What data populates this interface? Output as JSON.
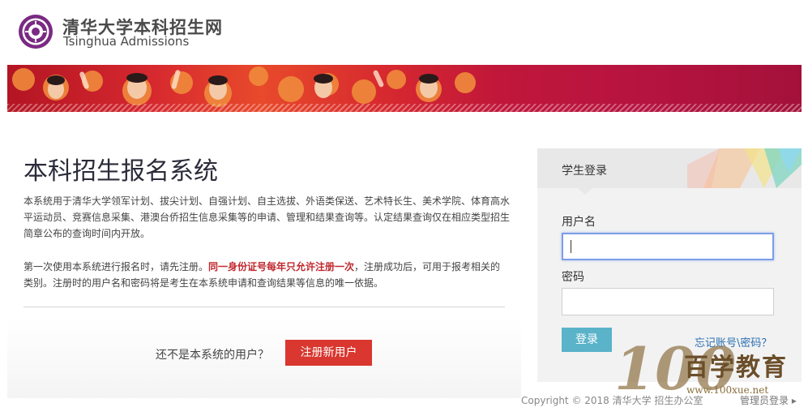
{
  "brand": {
    "name_cn": "清华大学本科招生网",
    "name_en": "Tsinghua Admissions"
  },
  "main": {
    "title": "本科招生报名系统",
    "para1": "本系统用于清华大学领军计划、拔尖计划、自强计划、自主选拔、外语类保送、艺术特长生、美术学院、体育高水平运动员、竞赛信息采集、港澳台侨招生信息采集等的申请、管理和结果查询等。认定结果查询仅在相应类型招生简章公布的查询时间内开放。",
    "para2_before": "第一次使用本系统进行报名时，请先注册。",
    "para2_emphasis": "同一身份证号每年只允许注册一次",
    "para2_after": "，注册成功后，可用于报考相关的类别。注册时的用户名和密码将是考生在本系统申请和查询结果等信息的唯一依据。",
    "not_user_text": "还不是本系统的用户？",
    "register_label": "注册新用户"
  },
  "login": {
    "title": "学生登录",
    "username_label": "用户名",
    "username_value": "",
    "password_label": "密码",
    "password_value": "",
    "submit_label": "登录",
    "forgot_label": "忘记账号\\密码？"
  },
  "footer": {
    "copyright": "Copyright © 2018 清华大学 招生办公室",
    "admin_login": "管理员登录 ▸"
  },
  "watermark": {
    "logo_text": "100",
    "name_cn": "百学教育",
    "url": "www.100xue.net"
  },
  "colors": {
    "banner_red": "#d6282f",
    "register_button": "#d9372f",
    "login_button": "#5ab3c8",
    "link_blue": "#2a6fb0",
    "emphasis_red": "#c0272d",
    "seal_purple": "#7a2a83"
  },
  "icons": {
    "seal": "tsinghua-seal-icon",
    "banner": "students-banner-image"
  }
}
